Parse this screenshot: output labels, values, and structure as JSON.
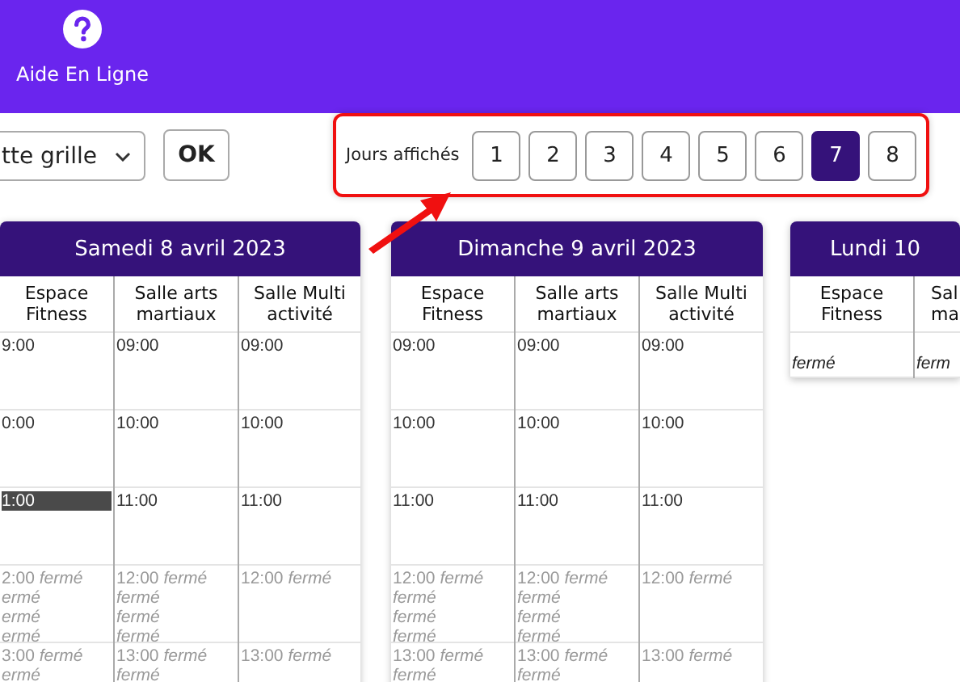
{
  "header": {
    "help_label": "Aide En Ligne"
  },
  "toolbar": {
    "grid_select": "tte grille",
    "ok_button": "OK",
    "days_label": "Jours affichés",
    "day_buttons": [
      {
        "label": "1",
        "selected": false
      },
      {
        "label": "2",
        "selected": false
      },
      {
        "label": "3",
        "selected": false
      },
      {
        "label": "4",
        "selected": false
      },
      {
        "label": "5",
        "selected": false
      },
      {
        "label": "6",
        "selected": false
      },
      {
        "label": "7",
        "selected": true
      },
      {
        "label": "8",
        "selected": false
      }
    ]
  },
  "days": [
    {
      "title": "Samedi 8 avril 2023",
      "columns": [
        {
          "heading": "Espace Fitness",
          "slots": [
            {
              "kind": "open",
              "time": "9:00"
            },
            {
              "kind": "open",
              "time": "0:00"
            },
            {
              "kind": "current",
              "time": "1:00"
            },
            {
              "kind": "closed",
              "time": "2:00",
              "notes": [
                "fermé",
                "ermé",
                "ermé",
                "ermé"
              ]
            },
            {
              "kind": "closed",
              "time": "3:00",
              "notes": [
                "fermé",
                "ermé"
              ]
            }
          ]
        },
        {
          "heading": "Salle arts martiaux",
          "slots": [
            {
              "kind": "open",
              "time": "09:00"
            },
            {
              "kind": "open",
              "time": "10:00"
            },
            {
              "kind": "open",
              "time": "11:00"
            },
            {
              "kind": "closed",
              "time": "12:00",
              "notes": [
                "fermé",
                "fermé",
                "fermé",
                "fermé"
              ]
            },
            {
              "kind": "closed",
              "time": "13:00",
              "notes": [
                "fermé",
                "fermé"
              ]
            }
          ]
        },
        {
          "heading": "Salle Multi activité",
          "slots": [
            {
              "kind": "open",
              "time": "09:00"
            },
            {
              "kind": "open",
              "time": "10:00"
            },
            {
              "kind": "open",
              "time": "11:00"
            },
            {
              "kind": "closed",
              "time": "12:00",
              "notes": [
                "fermé"
              ]
            },
            {
              "kind": "closed",
              "time": "13:00",
              "notes": [
                "fermé"
              ]
            }
          ]
        }
      ]
    },
    {
      "title": "Dimanche 9 avril 2023",
      "columns": [
        {
          "heading": "Espace Fitness",
          "slots": [
            {
              "kind": "open",
              "time": "09:00"
            },
            {
              "kind": "open",
              "time": "10:00"
            },
            {
              "kind": "open",
              "time": "11:00"
            },
            {
              "kind": "closed",
              "time": "12:00",
              "notes": [
                "fermé",
                "fermé",
                "fermé",
                "fermé"
              ]
            },
            {
              "kind": "closed",
              "time": "13:00",
              "notes": [
                "fermé",
                "fermé"
              ]
            }
          ]
        },
        {
          "heading": "Salle arts martiaux",
          "slots": [
            {
              "kind": "open",
              "time": "09:00"
            },
            {
              "kind": "open",
              "time": "10:00"
            },
            {
              "kind": "open",
              "time": "11:00"
            },
            {
              "kind": "closed",
              "time": "12:00",
              "notes": [
                "fermé",
                "fermé",
                "fermé",
                "fermé"
              ]
            },
            {
              "kind": "closed",
              "time": "13:00",
              "notes": [
                "fermé",
                "fermé"
              ]
            }
          ]
        },
        {
          "heading": "Salle Multi activité",
          "slots": [
            {
              "kind": "open",
              "time": "09:00"
            },
            {
              "kind": "open",
              "time": "10:00"
            },
            {
              "kind": "open",
              "time": "11:00"
            },
            {
              "kind": "closed",
              "time": "12:00",
              "notes": [
                "fermé"
              ]
            },
            {
              "kind": "closed",
              "time": "13:00",
              "notes": [
                "fermé"
              ]
            }
          ]
        }
      ]
    },
    {
      "title": "Lundi 10",
      "columns": [
        {
          "heading": "Espace Fitness",
          "slots": [
            {
              "kind": "closed",
              "notes": [
                "fermé"
              ]
            }
          ]
        },
        {
          "heading": "Sal ma",
          "slots": [
            {
              "kind": "closed",
              "notes": [
                "ferm"
              ]
            }
          ]
        }
      ]
    }
  ]
}
